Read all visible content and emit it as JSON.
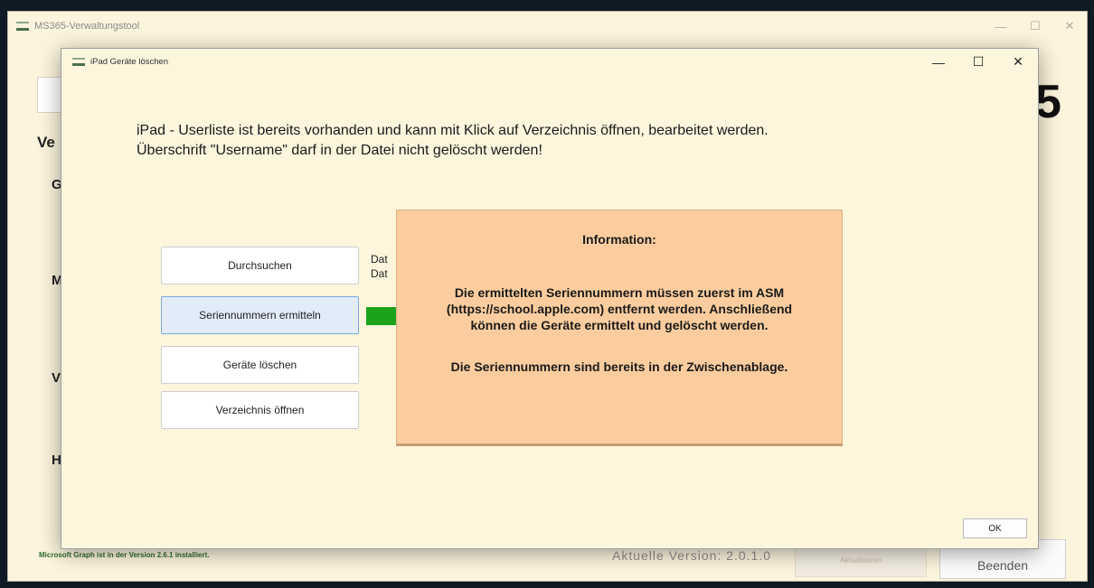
{
  "main_window": {
    "title": "MS365-Verwaltungstool",
    "controls": {
      "minimize": "—",
      "maximize": "☐",
      "close": "✕"
    },
    "left_fragments": [
      "Ve",
      "G",
      "M",
      "V",
      "H"
    ],
    "big_char": "5",
    "status": "Microsoft Graph ist in der Version 2.6.1 installiert.",
    "version": "Aktuelle Version: 2.0.1.0",
    "update_button": "Aktualisieren",
    "exit_button": "Beenden"
  },
  "dialog": {
    "title": "iPad Geräte löschen",
    "controls": {
      "minimize": "—",
      "maximize": "☐",
      "close": "✕"
    },
    "headline_line1": "iPad - Userliste ist bereits vorhanden und kann mit Klick auf Verzeichnis öffnen, bearbeitet werden.",
    "headline_line2": "Überschrift \"Username\" darf in der Datei nicht gelöscht werden!",
    "buttons": {
      "browse": "Durchsuchen",
      "serials": "Seriennummern ermitteln",
      "delete": "Geräte löschen",
      "open_dir": "Verzeichnis öffnen"
    },
    "file_labels": [
      "Dat",
      "Dat"
    ],
    "progress_color": "#1ba31b"
  },
  "info": {
    "title": "Information:",
    "p1_line1": "Die ermittelten Seriennummern müssen zuerst im ASM",
    "p1_line2": "(https://school.apple.com) entfernt werden. Anschließend",
    "p1_line3": "können die Geräte ermittelt und gelöscht werden.",
    "p2": "Die Seriennummern sind bereits in der Zwischenablage.",
    "ok_label": "OK"
  },
  "colors": {
    "background": "#fcf4dc",
    "info_background": "#fbcd9e",
    "active_button": "#e1ecf8",
    "status_green": "#2e6b2e"
  }
}
